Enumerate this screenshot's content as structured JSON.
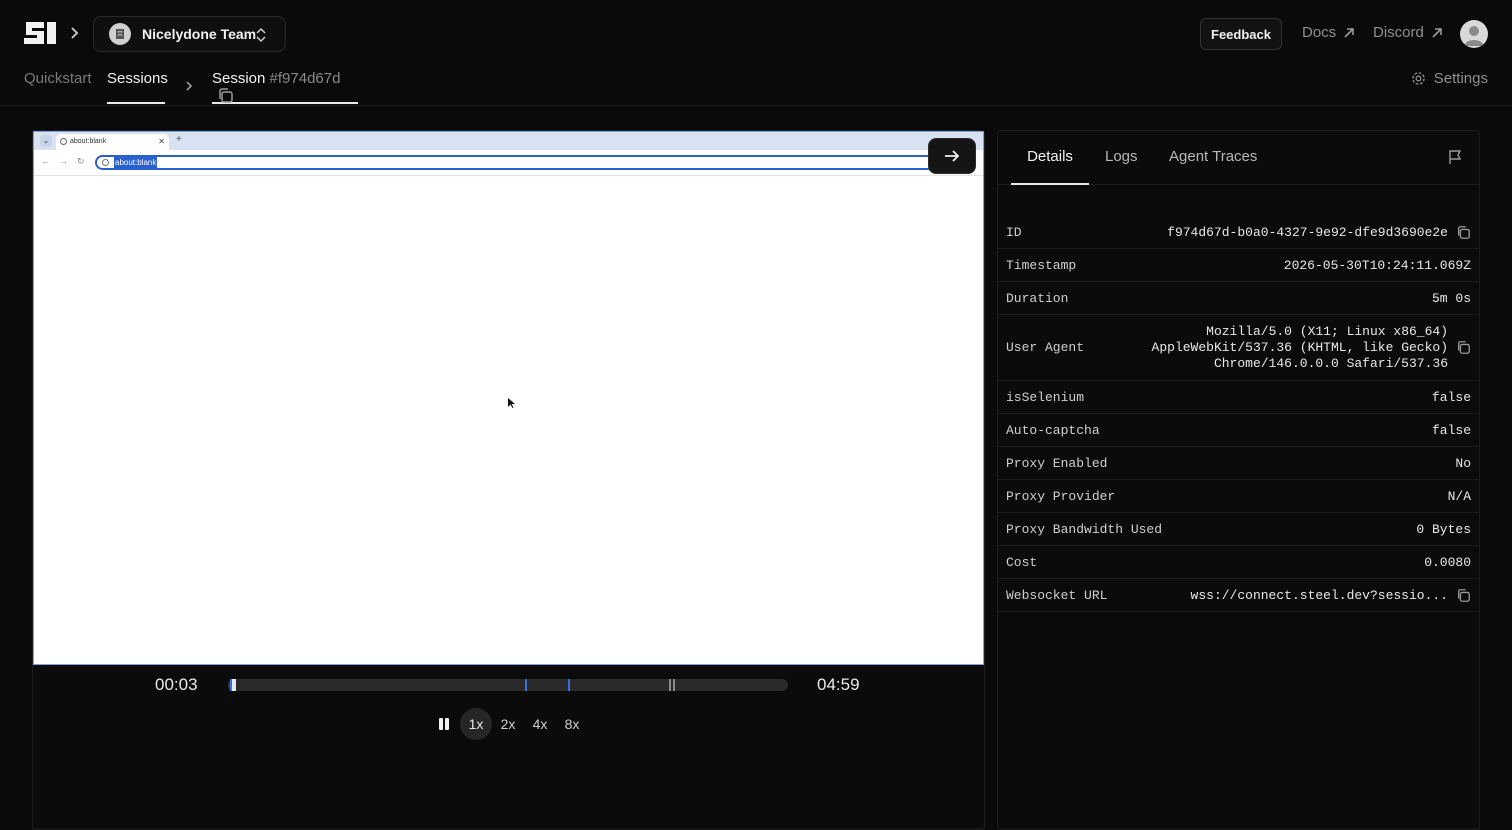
{
  "header": {
    "team_name": "Nicelydone Team",
    "feedback_label": "Feedback",
    "docs_label": "Docs",
    "discord_label": "Discord"
  },
  "nav": {
    "quickstart": "Quickstart",
    "sessions": "Sessions",
    "session_label": "Session",
    "session_hash": "#f974d67d",
    "settings": "Settings"
  },
  "browser": {
    "tab_title": "about:blank",
    "address": "about:blank"
  },
  "player": {
    "current_time": "00:03",
    "total_time": "04:59",
    "progress_fraction": 0.01,
    "speeds": [
      "1x",
      "2x",
      "4x",
      "8x"
    ],
    "active_speed": "1x",
    "accent": "#3b6fd6"
  },
  "details": {
    "tabs": [
      "Details",
      "Logs",
      "Agent Traces"
    ],
    "rows": [
      {
        "label": "ID",
        "value": "f974d67d-b0a0-4327-9e92-dfe9d3690e2e"
      },
      {
        "label": "Timestamp",
        "value": "2026-05-30T10:24:11.069Z"
      },
      {
        "label": "Duration",
        "value": "5m 0s"
      },
      {
        "label": "User Agent",
        "value_lines": [
          "Mozilla/5.0 (X11; Linux x86_64)",
          "AppleWebKit/537.36 (KHTML, like Gecko)",
          "Chrome/146.0.0.0 Safari/537.36"
        ]
      },
      {
        "label": "isSelenium",
        "value": "false"
      },
      {
        "label": "Auto-captcha",
        "value": "false"
      },
      {
        "label": "Proxy Enabled",
        "value": "No"
      },
      {
        "label": "Proxy Provider",
        "value": "N/A"
      },
      {
        "label": "Proxy Bandwidth Used",
        "value": "0 Bytes"
      },
      {
        "label": "Cost",
        "value": "0.0080"
      },
      {
        "label": "Websocket URL",
        "value": "wss://connect.steel.dev?sessio..."
      }
    ]
  }
}
